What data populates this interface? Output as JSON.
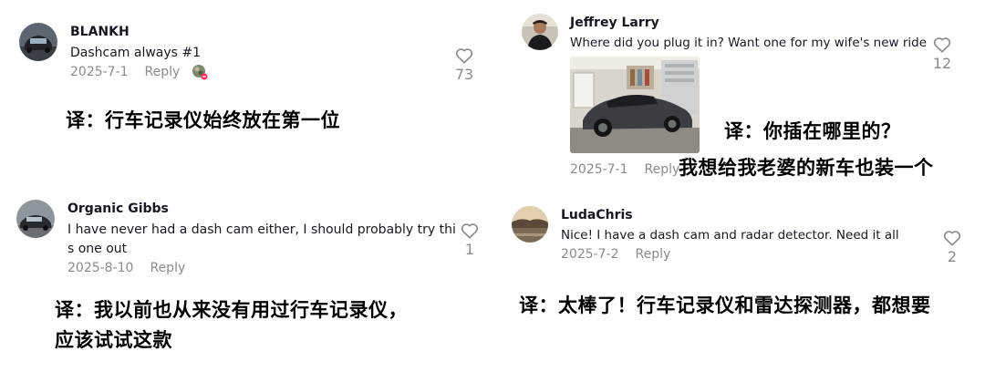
{
  "comments": [
    {
      "username": "BLANKH",
      "text": "Dashcam always #1",
      "date": "2025-7-1",
      "reply": "Reply",
      "likes": "73",
      "translation": "译：行车记录仪始终放在第一位"
    },
    {
      "username": "Organic Gibbs",
      "text_line1": "I have never had a dash cam either, I should probably try thi",
      "text_line2": "s one out",
      "date": "2025-8-10",
      "reply": "Reply",
      "likes": "1",
      "translation_line1": "译：我以前也从来没有用过行车记录仪，",
      "translation_line2": "应该试试这款"
    },
    {
      "username": "Jeffrey Larry",
      "text": "Where did you plug it in? Want one for my wife's new ride",
      "date": "2025-7-1",
      "reply": "Reply",
      "likes": "12",
      "translation_line1": "译：你插在哪里的？",
      "translation_line2": "我想给我老婆的新车也装一个"
    },
    {
      "username": "LudaChris",
      "text": "Nice! I have a dash cam and radar detector. Need it all",
      "date": "2025-7-2",
      "reply": "Reply",
      "likes": "2",
      "translation": "译：太棒了！行车记录仪和雷达探测器，都想要"
    }
  ],
  "colors": {
    "text": "#161823",
    "meta": "#8a8b91",
    "heart_stroke": "#8a8b91"
  },
  "icons": [
    "heart-outline-icon",
    "sticker-icon"
  ]
}
